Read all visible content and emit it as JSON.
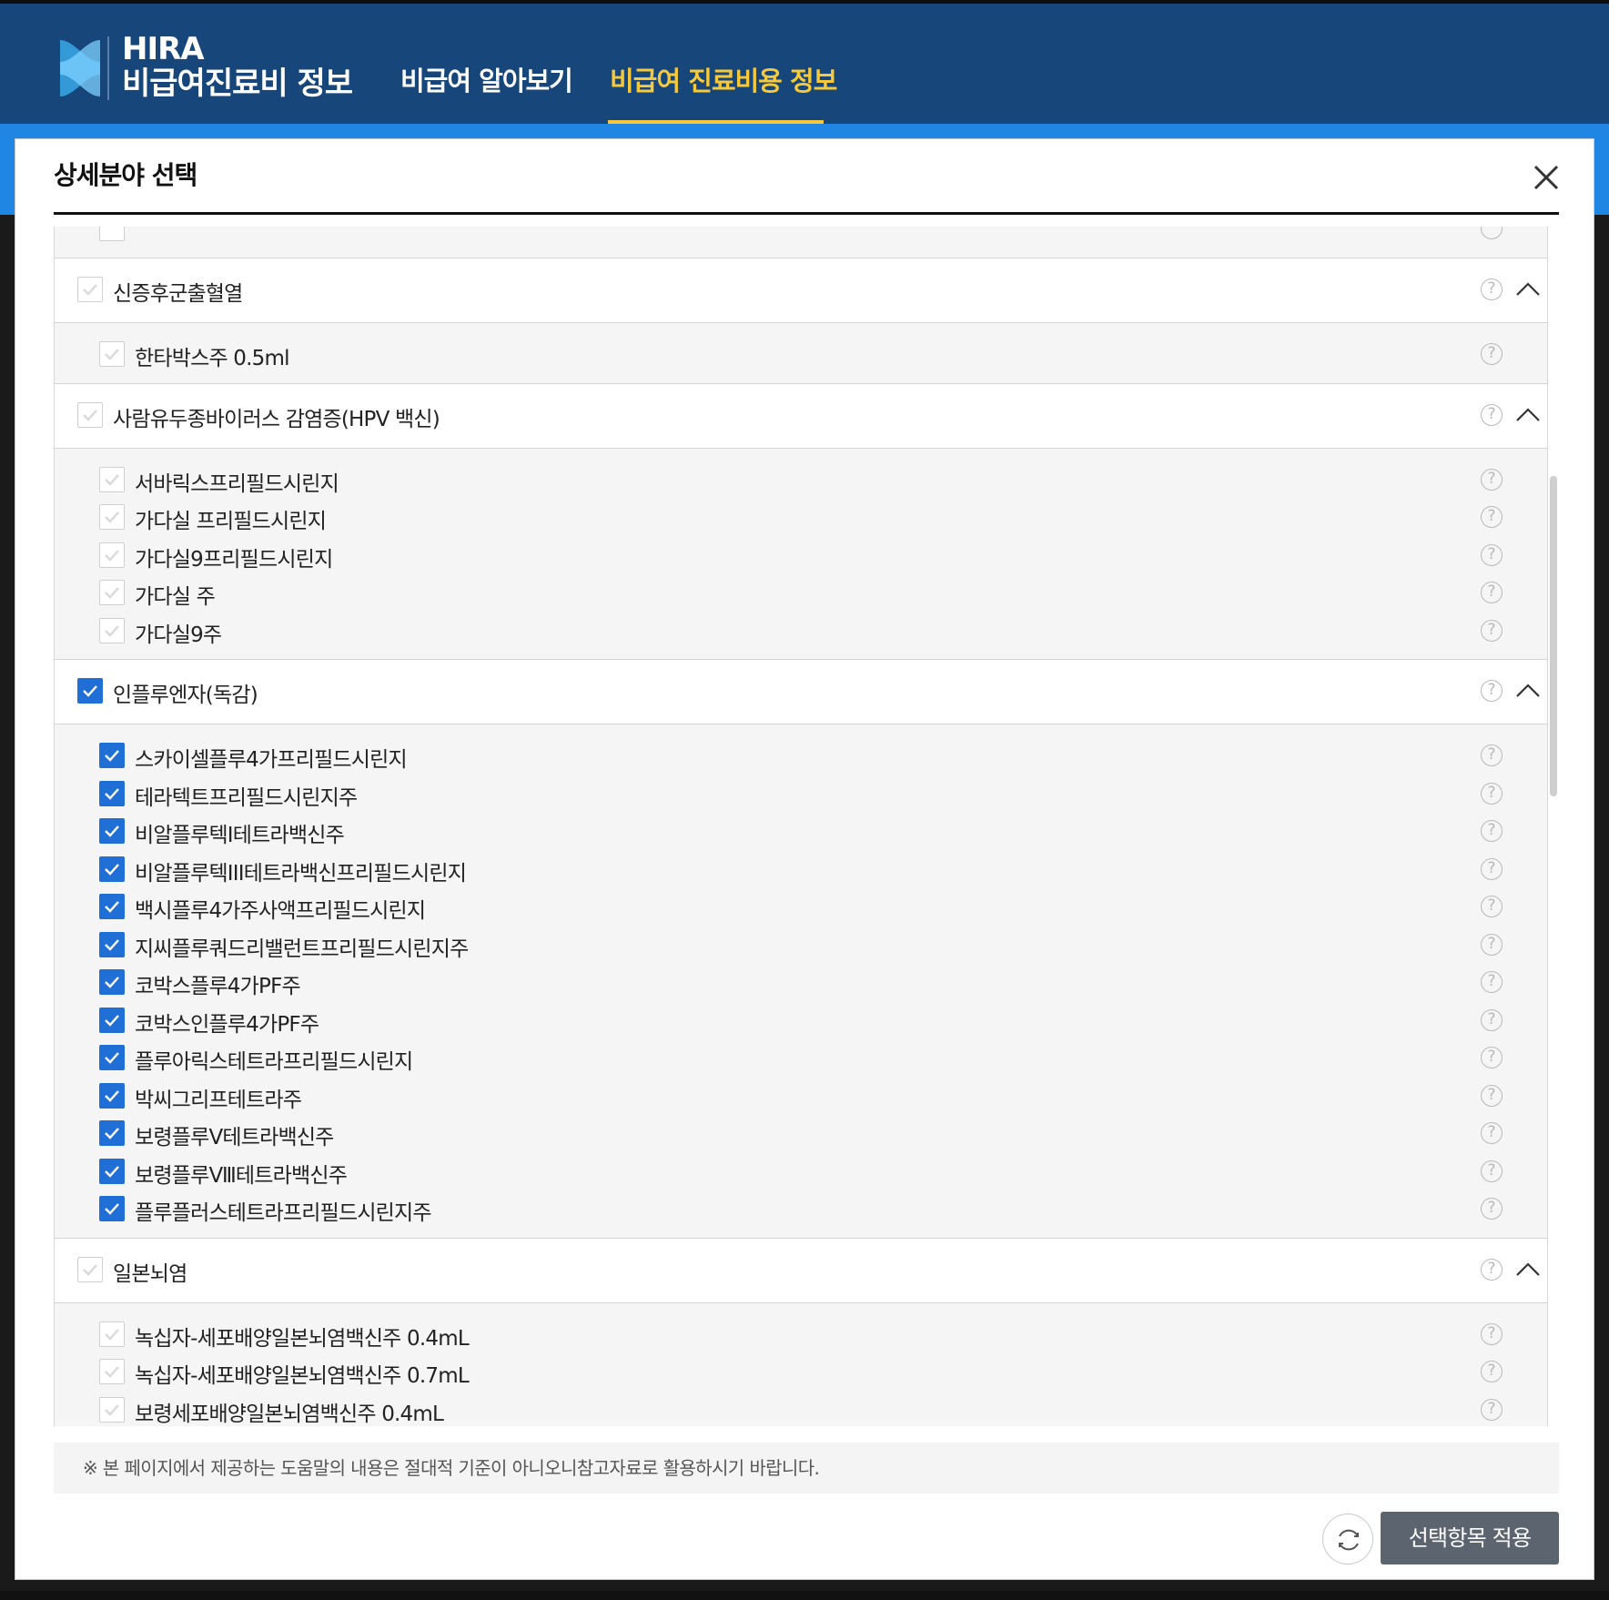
{
  "header": {
    "brand_en": "HIRA",
    "brand_ko": "비급여진료비 정보",
    "nav": [
      {
        "label": "비급여 알아보기",
        "active": false
      },
      {
        "label": "비급여 진료비용 정보",
        "active": true
      }
    ],
    "accent_color": "#f5c93b",
    "bg_color": "#16467a"
  },
  "modal": {
    "title": "상세분야 선택",
    "close_icon": "close-icon",
    "groups": [
      {
        "label": "신증후군출혈열",
        "checked": false,
        "expanded": true,
        "items": [
          {
            "label": "한타박스주 0.5ml",
            "checked": false
          }
        ]
      },
      {
        "label": "사람유두종바이러스 감염증(HPV 백신)",
        "checked": false,
        "expanded": true,
        "items": [
          {
            "label": "서바릭스프리필드시린지",
            "checked": false
          },
          {
            "label": "가다실 프리필드시린지",
            "checked": false
          },
          {
            "label": "가다실9프리필드시린지",
            "checked": false
          },
          {
            "label": "가다실 주",
            "checked": false
          },
          {
            "label": "가다실9주",
            "checked": false
          }
        ]
      },
      {
        "label": "인플루엔자(독감)",
        "checked": true,
        "expanded": true,
        "items": [
          {
            "label": "스카이셀플루4가프리필드시린지",
            "checked": true
          },
          {
            "label": "테라텍트프리필드시린지주",
            "checked": true
          },
          {
            "label": "비알플루텍I테트라백신주",
            "checked": true
          },
          {
            "label": "비알플루텍III테트라백신프리필드시린지",
            "checked": true
          },
          {
            "label": "백시플루4가주사액프리필드시린지",
            "checked": true
          },
          {
            "label": "지씨플루쿼드리밸런트프리필드시린지주",
            "checked": true
          },
          {
            "label": "코박스플루4가PF주",
            "checked": true
          },
          {
            "label": "코박스인플루4가PF주",
            "checked": true
          },
          {
            "label": "플루아릭스테트라프리필드시린지",
            "checked": true
          },
          {
            "label": "박씨그리프테트라주",
            "checked": true
          },
          {
            "label": "보령플루Ⅴ테트라백신주",
            "checked": true
          },
          {
            "label": "보령플루Ⅷ테트라백신주",
            "checked": true
          },
          {
            "label": "플루플러스테트라프리필드시린지주",
            "checked": true
          }
        ]
      },
      {
        "label": "일본뇌염",
        "checked": false,
        "expanded": true,
        "items": [
          {
            "label": "녹십자-세포배양일본뇌염백신주 0.4mL",
            "checked": false
          },
          {
            "label": "녹십자-세포배양일본뇌염백신주 0.7mL",
            "checked": false
          },
          {
            "label": "보령세포배양일본뇌염백신주 0.4mL",
            "checked": false
          }
        ]
      }
    ],
    "notice": "※ 본 페이지에서 제공하는 도움말의 내용은 절대적 기준이 아니오니참고자료로 활용하시기 바랍니다.",
    "apply_label": "선택항목 적용",
    "help_glyph": "?"
  }
}
